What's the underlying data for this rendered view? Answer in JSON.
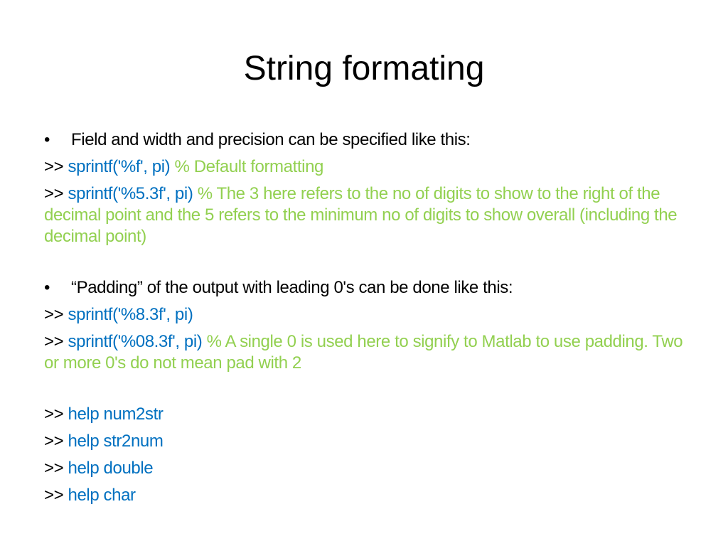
{
  "slide": {
    "title": "String formating",
    "colors": {
      "code": "#0070C0",
      "comment": "#92D050",
      "text": "#000000"
    },
    "section1": {
      "bullet": "•",
      "heading": "Field and width and precision can be specified like this:",
      "lines": [
        {
          "prompt": ">>",
          "code": "sprintf('%f', pi)",
          "comment": "% Default formatting"
        },
        {
          "prompt": ">>",
          "code": "sprintf('%5.3f', pi)",
          "comment": "% The 3 here refers to the no of digits to show to the right of the decimal point and the 5 refers to the minimum no of digits to show overall (including the decimal point)"
        }
      ]
    },
    "section2": {
      "bullet": "•",
      "heading": "“Padding” of the output with leading 0's can be done like this:",
      "lines": [
        {
          "prompt": ">>",
          "code": "sprintf('%8.3f', pi)",
          "comment": ""
        },
        {
          "prompt": ">>",
          "code": "sprintf('%08.3f', pi)",
          "comment": "% A single 0 is used here to signify to Matlab to use padding. Two or more 0's do not mean pad with 2"
        }
      ]
    },
    "help_commands": [
      {
        "prompt": ">>",
        "code": "help num2str"
      },
      {
        "prompt": ">>",
        "code": "help str2num"
      },
      {
        "prompt": ">>",
        "code": "help double"
      },
      {
        "prompt": ">>",
        "code": "help char"
      }
    ]
  }
}
